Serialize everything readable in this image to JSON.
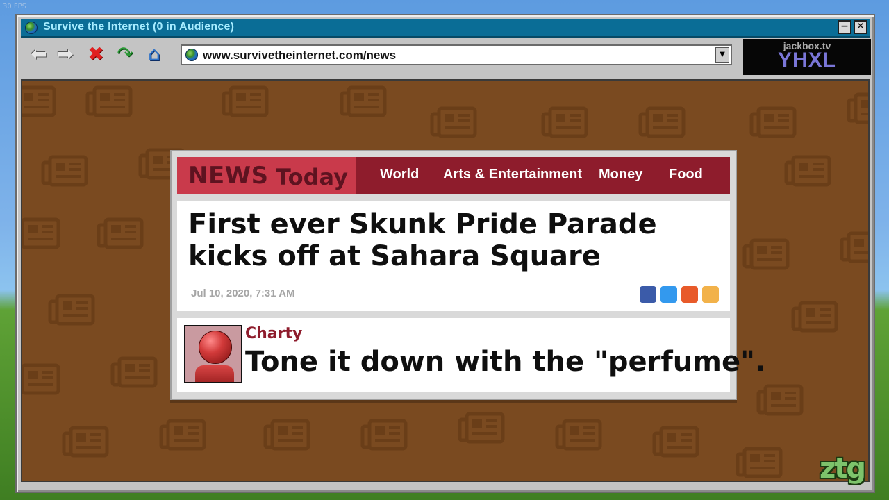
{
  "overlay": {
    "fps": "30 FPS"
  },
  "window": {
    "title": "Survive the Internet  (0 in Audience)",
    "minimize_symbol": "−",
    "close_symbol": "✕"
  },
  "toolbar": {
    "icons": {
      "back": "back-arrow-icon",
      "forward": "forward-arrow-icon",
      "stop": "stop-x-icon",
      "refresh": "refresh-arrow-icon",
      "home": "home-icon"
    },
    "url": "www.survivetheinternet.com/news",
    "dropdown_symbol": "▼"
  },
  "room": {
    "site": "jackbox.tv",
    "code": "YHXL"
  },
  "news": {
    "brand_news": "NEWS",
    "brand_today": "Today",
    "nav": [
      "World",
      "Arts & Entertainment",
      "Money",
      "Food"
    ],
    "headline": "First ever Skunk Pride Parade kicks off at Sahara Square",
    "date": "Jul 10, 2020, 7:31 AM",
    "share_colors": [
      "#3b5ba9",
      "#3399ee",
      "#e85a2a",
      "#f2b24a"
    ]
  },
  "comment": {
    "author": "Charty",
    "text": "Tone it down with the \"perfume\"."
  },
  "colors": {
    "content_bg": "#7a4a20",
    "brand_red": "#c93a4b",
    "bar_dark": "#8e1c2c",
    "titlebar": "#0a6d96"
  },
  "watermark": "ztg"
}
